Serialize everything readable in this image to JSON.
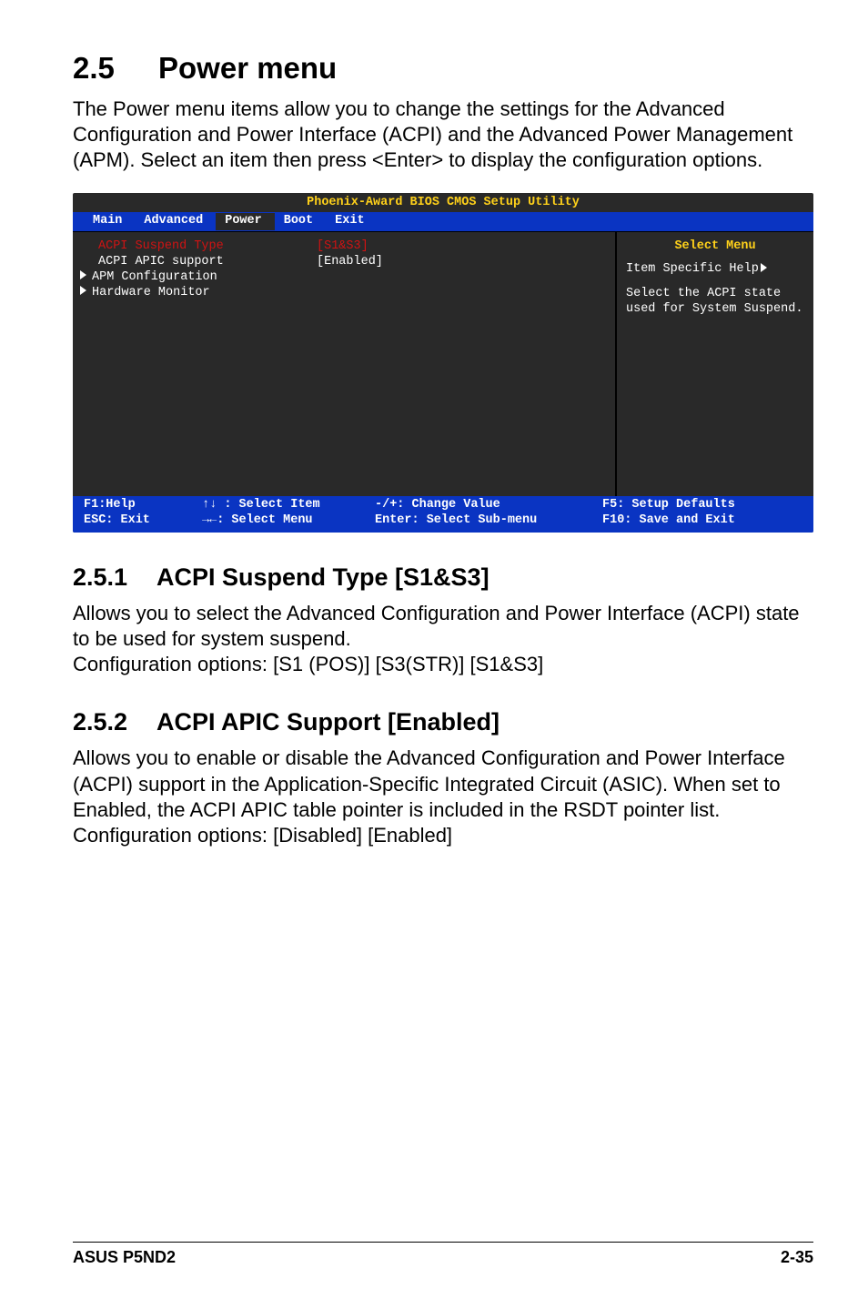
{
  "header": {
    "section_number": "2.5",
    "section_title": "Power menu",
    "intro": "The Power menu items allow you to change the settings for the Advanced Configuration and Power Interface (ACPI) and the Advanced Power Management (APM). Select an item then press <Enter> to display the configuration options."
  },
  "bios": {
    "title": "Phoenix-Award BIOS CMOS Setup Utility",
    "menubar": [
      "Main",
      "Advanced",
      "Power",
      "Boot",
      "Exit"
    ],
    "active_tab": "Power",
    "left_items": [
      {
        "label": "ACPI Suspend Type",
        "value": "[S1&S3]",
        "style": "red",
        "marker": "none"
      },
      {
        "label": "ACPI APIC support",
        "value": "[Enabled]",
        "style": "white",
        "marker": "none"
      },
      {
        "label": "APM Configuration",
        "value": "",
        "style": "white",
        "marker": "tri"
      },
      {
        "label": "Hardware Monitor",
        "value": "",
        "style": "white",
        "marker": "tri"
      }
    ],
    "right": {
      "title": "Select Menu",
      "help_label": "Item Specific Help",
      "body": "Select the ACPI state used for System Suspend."
    },
    "foot": {
      "f1": "F1:Help",
      "esc": "ESC: Exit",
      "sel_item": ": Select Item",
      "sel_menu": ": Select Menu",
      "chg": "-/+: Change Value",
      "enter": "Enter: Select Sub-menu",
      "f5": "F5: Setup Defaults",
      "f10": "F10: Save and Exit"
    }
  },
  "sub1": {
    "num": "2.5.1",
    "title": "ACPI Suspend Type [S1&S3]",
    "p1": "Allows you to select the Advanced Configuration and Power Interface (ACPI) state to be used for system suspend.",
    "p2": "Configuration options: [S1 (POS)] [S3(STR)] [S1&S3]"
  },
  "sub2": {
    "num": "2.5.2",
    "title": "ACPI APIC Support [Enabled]",
    "p1": "Allows you to enable or disable the Advanced Configuration and Power Interface (ACPI) support in the Application-Specific Integrated Circuit (ASIC). When set to Enabled, the ACPI APIC table pointer is included in the RSDT pointer list. Configuration options: [Disabled] [Enabled]"
  },
  "footer": {
    "left": "ASUS P5ND2",
    "right": "2-35"
  }
}
